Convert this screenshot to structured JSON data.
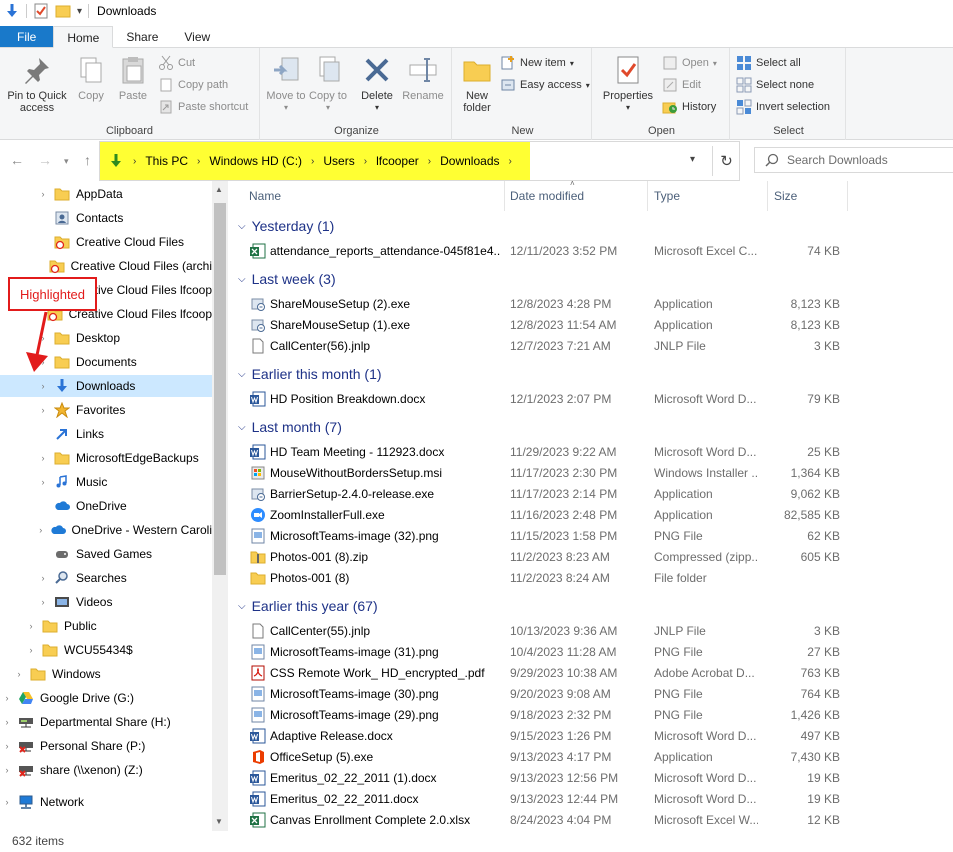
{
  "window": {
    "title": "Downloads"
  },
  "tabs": [
    {
      "label": "File"
    },
    {
      "label": "Home"
    },
    {
      "label": "Share"
    },
    {
      "label": "View"
    }
  ],
  "ribbon": {
    "clipboard": {
      "label": "Clipboard",
      "pin": "Pin to Quick access",
      "copy": "Copy",
      "paste": "Paste",
      "cut": "Cut",
      "copy_path": "Copy path",
      "paste_shortcut": "Paste shortcut"
    },
    "organize": {
      "label": "Organize",
      "move_to": "Move to",
      "copy_to": "Copy to",
      "delete": "Delete",
      "rename": "Rename"
    },
    "new": {
      "label": "New",
      "new_folder": "New folder",
      "new_item": "New item",
      "easy_access": "Easy access"
    },
    "open": {
      "label": "Open",
      "properties": "Properties",
      "open": "Open",
      "edit": "Edit",
      "history": "History"
    },
    "select": {
      "label": "Select",
      "select_all": "Select all",
      "select_none": "Select none",
      "invert": "Invert selection"
    }
  },
  "address": {
    "crumbs": [
      "This PC",
      "Windows HD (C:)",
      "Users",
      "lfcooper",
      "Downloads"
    ],
    "search_placeholder": "Search Downloads",
    "highlight_color": "#ffff33"
  },
  "navpane": {
    "items": [
      {
        "label": "AppData",
        "icon": "folder-icon",
        "expander": "›"
      },
      {
        "label": "Contacts",
        "icon": "contacts-icon",
        "expander": ""
      },
      {
        "label": "Creative Cloud Files",
        "icon": "cc-folder-icon",
        "expander": ""
      },
      {
        "label": "Creative Cloud Files (archi",
        "icon": "cc-folder-icon",
        "expander": ""
      },
      {
        "label": "Creative Cloud Files lfcoop",
        "icon": "cc-folder-icon",
        "expander": ""
      },
      {
        "label": "Creative Cloud Files lfcoop",
        "icon": "cc-folder-icon",
        "expander": ""
      },
      {
        "label": "Desktop",
        "icon": "folder-icon",
        "expander": "›"
      },
      {
        "label": "Documents",
        "icon": "folder-icon",
        "expander": "›"
      },
      {
        "label": "Downloads",
        "icon": "download-icon",
        "expander": "›"
      },
      {
        "label": "Favorites",
        "icon": "star-icon",
        "expander": "›"
      },
      {
        "label": "Links",
        "icon": "link-icon",
        "expander": ""
      },
      {
        "label": "MicrosoftEdgeBackups",
        "icon": "folder-icon",
        "expander": "›"
      },
      {
        "label": "Music",
        "icon": "music-icon",
        "expander": "›"
      },
      {
        "label": "OneDrive",
        "icon": "cloud-icon",
        "expander": ""
      },
      {
        "label": "OneDrive - Western Caroli",
        "icon": "cloud-icon",
        "expander": "›"
      },
      {
        "label": "Saved Games",
        "icon": "saved-games-icon",
        "expander": ""
      },
      {
        "label": "Searches",
        "icon": "search-icon",
        "expander": "›"
      },
      {
        "label": "Videos",
        "icon": "video-icon",
        "expander": "›"
      },
      {
        "label": "Public",
        "icon": "folder-icon",
        "expander": "›"
      },
      {
        "label": "WCU55434$",
        "icon": "folder-icon",
        "expander": "›"
      },
      {
        "label": "Windows",
        "icon": "folder-icon",
        "expander": "›"
      },
      {
        "label": "Google Drive (G:)",
        "icon": "google-drive-icon",
        "expander": "›"
      },
      {
        "label": "Departmental Share (H:)",
        "icon": "network-drive-icon",
        "expander": "›"
      },
      {
        "label": "Personal Share (P:)",
        "icon": "network-drive-disconnected-icon",
        "expander": "›"
      },
      {
        "label": "share (\\\\xenon) (Z:)",
        "icon": "network-drive-disconnected-icon",
        "expander": "›"
      },
      {
        "label": "Network",
        "icon": "network-icon",
        "expander": "›"
      }
    ],
    "selected": "Downloads"
  },
  "annotation": {
    "label": "Highlighted",
    "color": "#e21b1b"
  },
  "columns": {
    "name": "Name",
    "date": "Date modified",
    "type": "Type",
    "size": "Size"
  },
  "groups": [
    {
      "title": "Yesterday (1)",
      "rows": [
        {
          "name": "attendance_reports_attendance-045f81e4...",
          "date": "12/11/2023 3:52 PM",
          "type": "Microsoft Excel C...",
          "size": "74 KB",
          "icon": "excel-icon"
        }
      ]
    },
    {
      "title": "Last week (3)",
      "rows": [
        {
          "name": "ShareMouseSetup (2).exe",
          "date": "12/8/2023 4:28 PM",
          "type": "Application",
          "size": "8,123 KB",
          "icon": "installer-icon"
        },
        {
          "name": "ShareMouseSetup (1).exe",
          "date": "12/8/2023 11:54 AM",
          "type": "Application",
          "size": "8,123 KB",
          "icon": "installer-icon"
        },
        {
          "name": "CallCenter(56).jnlp",
          "date": "12/7/2023 7:21 AM",
          "type": "JNLP File",
          "size": "3 KB",
          "icon": "file-icon"
        }
      ]
    },
    {
      "title": "Earlier this month (1)",
      "rows": [
        {
          "name": "HD Position Breakdown.docx",
          "date": "12/1/2023 2:07 PM",
          "type": "Microsoft Word D...",
          "size": "79 KB",
          "icon": "word-icon"
        }
      ]
    },
    {
      "title": "Last month (7)",
      "rows": [
        {
          "name": "HD Team Meeting - 112923.docx",
          "date": "11/29/2023 9:22 AM",
          "type": "Microsoft Word D...",
          "size": "25 KB",
          "icon": "word-icon"
        },
        {
          "name": "MouseWithoutBordersSetup.msi",
          "date": "11/17/2023 2:30 PM",
          "type": "Windows Installer ...",
          "size": "1,364 KB",
          "icon": "msi-icon"
        },
        {
          "name": "BarrierSetup-2.4.0-release.exe",
          "date": "11/17/2023 2:14 PM",
          "type": "Application",
          "size": "9,062 KB",
          "icon": "installer-icon"
        },
        {
          "name": "ZoomInstallerFull.exe",
          "date": "11/16/2023 2:48 PM",
          "type": "Application",
          "size": "82,585 KB",
          "icon": "zoom-icon"
        },
        {
          "name": "MicrosoftTeams-image (32).png",
          "date": "11/15/2023 1:58 PM",
          "type": "PNG File",
          "size": "62 KB",
          "icon": "image-icon"
        },
        {
          "name": "Photos-001 (8).zip",
          "date": "11/2/2023 8:23 AM",
          "type": "Compressed (zipp...",
          "size": "605 KB",
          "icon": "zip-icon"
        },
        {
          "name": "Photos-001 (8)",
          "date": "11/2/2023 8:24 AM",
          "type": "File folder",
          "size": "",
          "icon": "folder-icon"
        }
      ]
    },
    {
      "title": "Earlier this year (67)",
      "rows": [
        {
          "name": "CallCenter(55).jnlp",
          "date": "10/13/2023 9:36 AM",
          "type": "JNLP File",
          "size": "3 KB",
          "icon": "file-icon"
        },
        {
          "name": "MicrosoftTeams-image (31).png",
          "date": "10/4/2023 11:28 AM",
          "type": "PNG File",
          "size": "27 KB",
          "icon": "image-icon"
        },
        {
          "name": "CSS Remote Work_ HD_encrypted_.pdf",
          "date": "9/29/2023 10:38 AM",
          "type": "Adobe Acrobat D...",
          "size": "763 KB",
          "icon": "pdf-icon"
        },
        {
          "name": "MicrosoftTeams-image (30).png",
          "date": "9/20/2023 9:08 AM",
          "type": "PNG File",
          "size": "764 KB",
          "icon": "image-icon"
        },
        {
          "name": "MicrosoftTeams-image (29).png",
          "date": "9/18/2023 2:32 PM",
          "type": "PNG File",
          "size": "1,426 KB",
          "icon": "image-icon"
        },
        {
          "name": "Adaptive Release.docx",
          "date": "9/15/2023 1:26 PM",
          "type": "Microsoft Word D...",
          "size": "497 KB",
          "icon": "word-icon"
        },
        {
          "name": "OfficeSetup (5).exe",
          "date": "9/13/2023 4:17 PM",
          "type": "Application",
          "size": "7,430 KB",
          "icon": "office-icon"
        },
        {
          "name": "Emeritus_02_22_2011 (1).docx",
          "date": "9/13/2023 12:56 PM",
          "type": "Microsoft Word D...",
          "size": "19 KB",
          "icon": "word-icon"
        },
        {
          "name": "Emeritus_02_22_2011.docx",
          "date": "9/13/2023 12:44 PM",
          "type": "Microsoft Word D...",
          "size": "19 KB",
          "icon": "word-icon"
        },
        {
          "name": "Canvas Enrollment Complete 2.0.xlsx",
          "date": "8/24/2023 4:04 PM",
          "type": "Microsoft Excel W...",
          "size": "12 KB",
          "icon": "excel-icon"
        }
      ]
    }
  ],
  "status": {
    "items": "632 items"
  }
}
